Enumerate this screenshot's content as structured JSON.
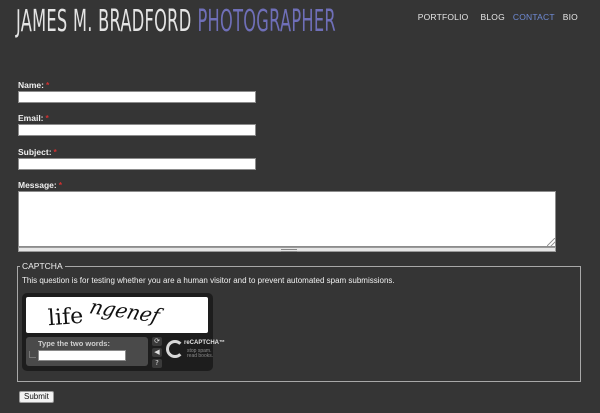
{
  "header": {
    "logo_name": "JAMES M. BRADFORD",
    "logo_role": "PHOTOGRAPHER",
    "nav": [
      {
        "label": "PORTFOLIO"
      },
      {
        "label": "BLOG"
      },
      {
        "label": "CONTACT",
        "active": true
      },
      {
        "label": "BIO"
      }
    ]
  },
  "form": {
    "required_mark": "*",
    "name_label": "Name:",
    "email_label": "Email:",
    "subject_label": "Subject:",
    "message_label": "Message:",
    "name_value": "",
    "email_value": "",
    "subject_value": "",
    "message_value": "",
    "submit_label": "Submit"
  },
  "captcha": {
    "legend": "CAPTCHA",
    "description": "This question is for testing whether you are a human visitor and to prevent automated spam submissions.",
    "word1": "life",
    "word2": "ngenef",
    "type_label": "Type the two words:",
    "input_value": "",
    "logo_text": "reCAPTCHA™",
    "logo_tagline_1": "stop spam.",
    "logo_tagline_2": "read books."
  },
  "icons": {
    "refresh": "refresh-icon",
    "audio": "audio-icon",
    "help": "help-icon"
  },
  "colors": {
    "background": "#353535",
    "logo_name": "#e4e4e4",
    "logo_role": "#6f6fb8",
    "nav_active": "#6f8bd6",
    "required": "#d03030"
  }
}
